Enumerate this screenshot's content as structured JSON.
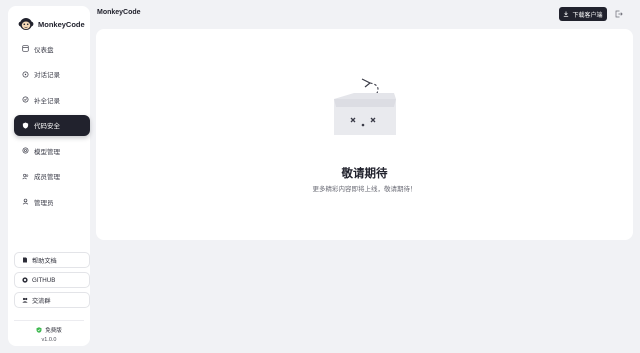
{
  "brand": {
    "name": "MonkeyCode",
    "logo_icon": "monkey-logo-icon"
  },
  "sidebar": {
    "items": [
      {
        "label": "仪表盘",
        "icon": "dashboard-icon",
        "active": false
      },
      {
        "label": "对话记录",
        "icon": "chat-icon",
        "active": false
      },
      {
        "label": "补全记录",
        "icon": "completion-icon",
        "active": false
      },
      {
        "label": "代码安全",
        "icon": "shield-icon",
        "active": true
      },
      {
        "label": "模型管理",
        "icon": "model-icon",
        "active": false
      },
      {
        "label": "成员管理",
        "icon": "users-icon",
        "active": false
      },
      {
        "label": "管理员",
        "icon": "admin-icon",
        "active": false
      }
    ],
    "links": [
      {
        "label": "帮助文档",
        "icon": "doc-icon"
      },
      {
        "label": "GITHUB",
        "icon": "github-icon"
      },
      {
        "label": "交流群",
        "icon": "group-icon"
      }
    ],
    "plan": "免费版",
    "version": "v1.0.0"
  },
  "topbar": {
    "title": "MonkeyCode",
    "download_label": "下载客户端",
    "logout_icon": "logout-icon"
  },
  "main": {
    "title": "敬请期待",
    "subtitle": "更多精彩内容即将上线，敬请期待！",
    "illustration": "empty-box-icon"
  },
  "colors": {
    "accent": "#21222d",
    "background": "#f1f2f5",
    "card": "#ffffff",
    "plan_badge": "#3fb950"
  }
}
